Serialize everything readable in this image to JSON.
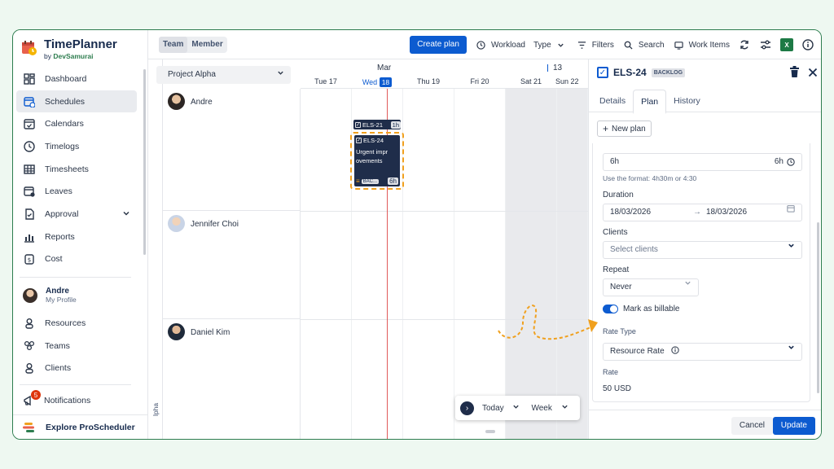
{
  "brand": {
    "title": "TimePlanner",
    "by": "by",
    "vendor": "DevSamurai"
  },
  "nav": [
    {
      "label": "Dashboard",
      "icon": "dashboard-icon"
    },
    {
      "label": "Schedules",
      "icon": "calendar-clock-icon",
      "active": true
    },
    {
      "label": "Calendars",
      "icon": "calendar-check-icon"
    },
    {
      "label": "Timelogs",
      "icon": "clock-icon"
    },
    {
      "label": "Timesheets",
      "icon": "table-icon"
    },
    {
      "label": "Leaves",
      "icon": "calendar-minus-icon"
    },
    {
      "label": "Approval",
      "icon": "approval-icon",
      "expandable": true
    },
    {
      "label": "Reports",
      "icon": "bar-chart-icon"
    },
    {
      "label": "Cost",
      "icon": "money-icon"
    }
  ],
  "profile": {
    "name": "Andre",
    "sub": "My Profile"
  },
  "nav2": [
    {
      "label": "Resources",
      "icon": "person-icon"
    },
    {
      "label": "Teams",
      "icon": "team-icon"
    },
    {
      "label": "Clients",
      "icon": "client-icon"
    }
  ],
  "notifications": {
    "label": "Notifications",
    "count": "5"
  },
  "explore": {
    "label": "Explore ProScheduler"
  },
  "topbar": {
    "tabs": [
      "Team",
      "Member"
    ],
    "create_plan": "Create plan",
    "workload": "Workload",
    "type": "Type",
    "filters": "Filters",
    "search": "Search",
    "work_items": "Work Items",
    "excel": "X"
  },
  "main": {
    "project": "Project Alpha",
    "month": "Mar",
    "week": "13",
    "days": [
      {
        "label": "Tue",
        "num": "17"
      },
      {
        "label": "Wed",
        "num": "18",
        "today": true
      },
      {
        "label": "Thu",
        "num": "19"
      },
      {
        "label": "Fri",
        "num": "20"
      },
      {
        "label": "Sat",
        "num": "21",
        "weekend": true
      },
      {
        "label": "Sun",
        "num": "22",
        "weekend": true
      }
    ],
    "resources": [
      "Andre",
      "Jennifer Choi",
      "Daniel Kim"
    ],
    "strip_text": "lpha",
    "task_small": {
      "id": "ELS-21",
      "hours": "1h"
    },
    "task_card": {
      "id": "ELS-24",
      "title": "Urgent impr ovements",
      "badge": "BAC...",
      "hours": "6h"
    },
    "floating": {
      "today": "Today",
      "week": "Week"
    }
  },
  "panel": {
    "key": "ELS-24",
    "badge": "BACKLOG",
    "tabs": [
      "Details",
      "Plan",
      "History"
    ],
    "new_plan": "New plan",
    "time_value": "6h",
    "time_right": "6h",
    "hint": "Use the format: 4h30m or 4:30",
    "duration_label": "Duration",
    "date_from": "18/03/2026",
    "date_to": "18/03/2026",
    "clients_label": "Clients",
    "clients_placeholder": "Select clients",
    "repeat_label": "Repeat",
    "repeat_value": "Never",
    "billable_label": "Mark as billable",
    "rate_type_label": "Rate Type",
    "rate_type_value": "Resource Rate",
    "rate_label": "Rate",
    "rate_value": "50 USD",
    "cancel": "Cancel",
    "update": "Update"
  },
  "colors": {
    "primary": "#0c5bd0",
    "brand_green": "#2e7d4f",
    "task_bg": "#1f2d4a",
    "annotation": "#f0a01e",
    "now_line": "#e05a5a"
  }
}
